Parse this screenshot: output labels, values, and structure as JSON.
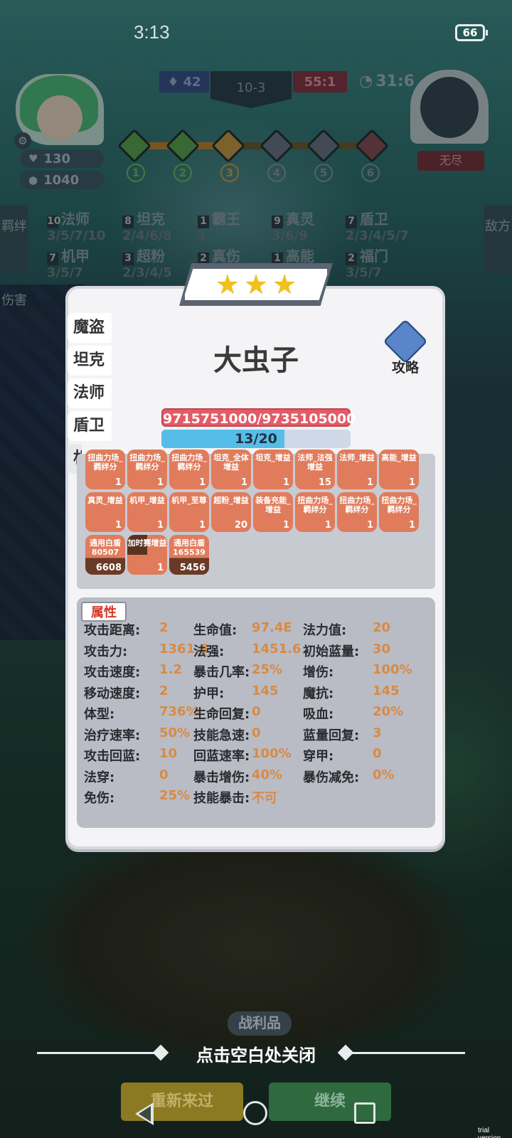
{
  "status": {
    "time": "3:13",
    "battery": "66"
  },
  "player": {
    "hp": "130",
    "gold": "1040"
  },
  "match": {
    "score_left": "42",
    "round": "10-3",
    "score_right": "55:1",
    "timer": "31:6"
  },
  "enemy": {
    "name": "无尽"
  },
  "stages": [
    "1",
    "2",
    "3",
    "4",
    "5",
    "6"
  ],
  "stage_progress": 0.4,
  "side_tabs": {
    "bonds": "羁绊",
    "damage": "伤害",
    "enemy": "敌方"
  },
  "synergies": [
    {
      "count": "10",
      "name": "法师",
      "tiers": "3/5/7/10"
    },
    {
      "count": "8",
      "name": "坦克",
      "tiers": "2/4/6/8"
    },
    {
      "count": "1",
      "name": "霸王",
      "tiers": "1"
    },
    {
      "count": "9",
      "name": "真灵",
      "tiers": "3/6/9"
    },
    {
      "count": "7",
      "name": "盾卫",
      "tiers": "2/3/4/5/7"
    },
    {
      "count": "7",
      "name": "机甲",
      "tiers": "3/5/7"
    },
    {
      "count": "3",
      "name": "超粉",
      "tiers": "2/3/4/5"
    },
    {
      "count": "2",
      "name": "真伤",
      "tiers": ""
    },
    {
      "count": "1",
      "name": "高能",
      "tiers": ""
    },
    {
      "count": "2",
      "name": "福门",
      "tiers": "3/5/7"
    }
  ],
  "popup": {
    "stars": 3,
    "unit_name": "大虫子",
    "guide_label": "攻略",
    "trait_tabs": [
      "魔盗",
      "坦克",
      "法师",
      "盾卫",
      "机"
    ],
    "hp_text": "9715751000/9735105000",
    "mana_text": "13/20",
    "mana_fraction": 0.65,
    "buffs": [
      {
        "label": "扭曲力场_羁绊分",
        "count": "1"
      },
      {
        "label": "扭曲力场_羁绊分",
        "count": "1"
      },
      {
        "label": "扭曲力场_羁绊分",
        "count": "1"
      },
      {
        "label": "坦克_全体增益",
        "count": "1"
      },
      {
        "label": "坦克_增益",
        "count": "1"
      },
      {
        "label": "法师_法强增益",
        "count": "15"
      },
      {
        "label": "法师_增益",
        "count": "1"
      },
      {
        "label": "高能_增益",
        "count": "1"
      },
      {
        "label": "真灵_增益",
        "count": "1"
      },
      {
        "label": "机甲_增益",
        "count": "1"
      },
      {
        "label": "机甲_至尊",
        "count": "1"
      },
      {
        "label": "超粉_增益",
        "count": "20"
      },
      {
        "label": "装备充能_增益",
        "count": "1"
      },
      {
        "label": "扭曲力场_羁绊分",
        "count": "1"
      },
      {
        "label": "扭曲力场_羁绊分",
        "count": "1"
      },
      {
        "label": "扭曲力场_羁绊分",
        "count": "1"
      },
      {
        "label": "通用白盾80507",
        "count": "6608"
      },
      {
        "label": "加时赛增益",
        "count": "1"
      },
      {
        "label": "通用白盾165539",
        "count": "5456"
      }
    ],
    "attr_title": "属性",
    "attributes": [
      {
        "name": "攻击距离:",
        "value": "2"
      },
      {
        "name": "生命值:",
        "value": "97.4E"
      },
      {
        "name": "法力值:",
        "value": "20"
      },
      {
        "name": "攻击力:",
        "value": "1361.8"
      },
      {
        "name": "法强:",
        "value": "1451.6"
      },
      {
        "name": "初始蓝量:",
        "value": "30"
      },
      {
        "name": "攻击速度:",
        "value": "1.2"
      },
      {
        "name": "暴击几率:",
        "value": "25%"
      },
      {
        "name": "增伤:",
        "value": "100%"
      },
      {
        "name": "移动速度:",
        "value": "2"
      },
      {
        "name": "护甲:",
        "value": "145"
      },
      {
        "name": "魔抗:",
        "value": "145"
      },
      {
        "name": "体型:",
        "value": "736%"
      },
      {
        "name": "生命回复:",
        "value": "0"
      },
      {
        "name": "吸血:",
        "value": "20%"
      },
      {
        "name": "治疗速率:",
        "value": "50%"
      },
      {
        "name": "技能急速:",
        "value": "0"
      },
      {
        "name": "蓝量回复:",
        "value": "3"
      },
      {
        "name": "攻击回蓝:",
        "value": "10"
      },
      {
        "name": "回蓝速率:",
        "value": "100%"
      },
      {
        "name": "穿甲:",
        "value": "0"
      },
      {
        "name": "法穿:",
        "value": "0"
      },
      {
        "name": "暴击增伤:",
        "value": "40%"
      },
      {
        "name": "暴伤减免:",
        "value": "0%"
      },
      {
        "name": "免伤:",
        "value": "25%"
      },
      {
        "name": "技能暴击:",
        "value": "不可"
      }
    ]
  },
  "bottom": {
    "close_hint": "点击空白处关闭",
    "spoils_label": "战利品",
    "retry_label": "重新来过",
    "continue_label": "继续"
  },
  "watermark": "trial version",
  "colors": {
    "hp_bar": "#e35b66",
    "mana_bar": "#56bde8",
    "buff_tile": "#e07c5c",
    "attr_value": "#d88a45",
    "star": "#f2c21b"
  }
}
